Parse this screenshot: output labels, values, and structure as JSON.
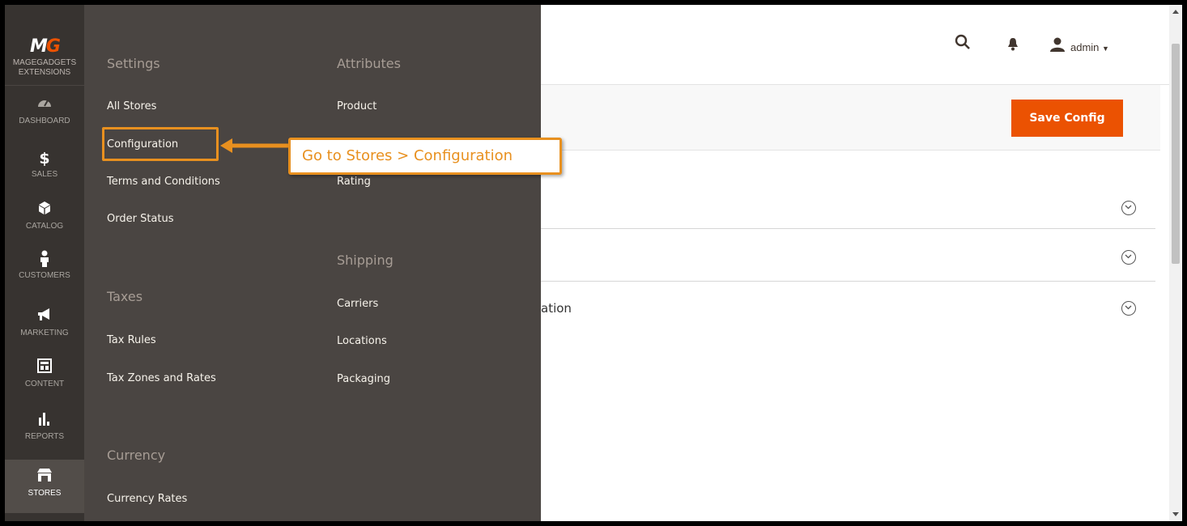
{
  "logo": {
    "mark_left": "M",
    "mark_right": "G",
    "line1": "MAGEGADGETS",
    "line2": "EXTENSIONS"
  },
  "nav": [
    {
      "label": "DASHBOARD",
      "icon": "dashboard-icon"
    },
    {
      "label": "SALES",
      "icon": "dollar-icon"
    },
    {
      "label": "CATALOG",
      "icon": "box-icon"
    },
    {
      "label": "CUSTOMERS",
      "icon": "person-icon"
    },
    {
      "label": "MARKETING",
      "icon": "megaphone-icon"
    },
    {
      "label": "CONTENT",
      "icon": "layout-icon"
    },
    {
      "label": "REPORTS",
      "icon": "bar-chart-icon"
    },
    {
      "label": "STORES",
      "icon": "store-icon",
      "active": true
    }
  ],
  "submenu": {
    "settings": {
      "heading": "Settings",
      "links": [
        "All Stores",
        "Configuration",
        "Terms and Conditions",
        "Order Status"
      ]
    },
    "taxes": {
      "heading": "Taxes",
      "links": [
        "Tax Rules",
        "Tax Zones and Rates"
      ]
    },
    "currency": {
      "heading": "Currency",
      "links": [
        "Currency Rates"
      ]
    },
    "attributes": {
      "heading": "Attributes",
      "links": [
        "Product",
        "Rating"
      ]
    },
    "shipping": {
      "heading": "Shipping",
      "links": [
        "Carriers",
        "Locations",
        "Packaging"
      ]
    }
  },
  "header": {
    "user": "admin",
    "search_icon": "search-icon",
    "bell_icon": "bell-icon"
  },
  "actions": {
    "save_label": "Save Config",
    "accent": "#eb5202"
  },
  "sections": {
    "partial_title": "ation"
  },
  "annotation": {
    "callout_text": "Go to Stores > Configuration",
    "color": "#e8901f"
  }
}
